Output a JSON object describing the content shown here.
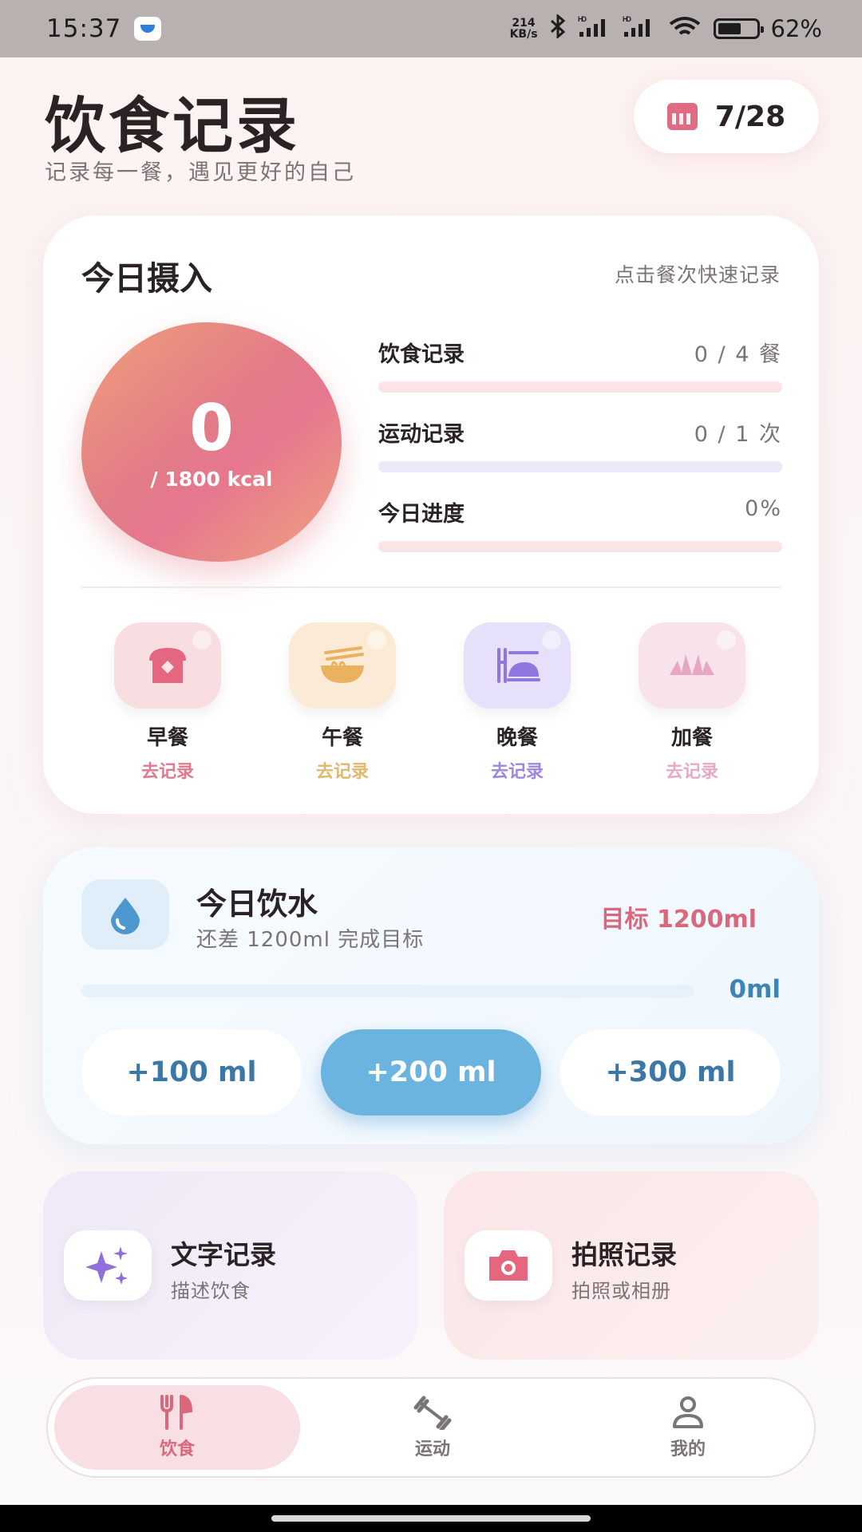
{
  "status_bar": {
    "time": "15:37",
    "net_speed_top": "214",
    "net_speed_bottom": "KB/s",
    "signal1": "HD",
    "signal2": "HD",
    "battery": "62%",
    "battery_level": 0.62
  },
  "header": {
    "title": "饮食记录",
    "subtitle": "记录每一餐，遇见更好的自己",
    "date": "7/28",
    "date_icon": "calendar-icon"
  },
  "intake": {
    "title": "今日摄入",
    "hint": "点击餐次快速记录",
    "kcal_value": "0",
    "kcal_goal": "/ 1800 kcal",
    "stats": [
      {
        "label": "饮食记录",
        "value": "0 / 4 餐",
        "progress": 0,
        "track_color": "#fbe4e6",
        "fill_color": "#e27b88"
      },
      {
        "label": "运动记录",
        "value": "0 / 1 次",
        "progress": 0,
        "track_color": "#ece8f8",
        "fill_color": "#9b86e0"
      },
      {
        "label": "今日进度",
        "value": "0%",
        "progress": 0,
        "track_color": "#fbe4e6",
        "fill_color": "#e27b88"
      }
    ],
    "meals": [
      {
        "name": "早餐",
        "action": "去记录",
        "icon": "toast-icon",
        "tile_color": "#f8dde1",
        "icon_color": "#e4677f",
        "action_color": "#e0798c"
      },
      {
        "name": "午餐",
        "action": "去记录",
        "icon": "noodle-bowl-icon",
        "tile_color": "#fbebd6",
        "icon_color": "#eab15e",
        "action_color": "#e2b76c"
      },
      {
        "name": "晚餐",
        "action": "去记录",
        "icon": "dinner-plate-icon",
        "tile_color": "#e6e0fb",
        "icon_color": "#8f77de",
        "action_color": "#9c86df"
      },
      {
        "name": "加餐",
        "action": "去记录",
        "icon": "croissant-icon",
        "tile_color": "#f8e3ec",
        "icon_color": "#e8a6c0",
        "action_color": "#e7a9c3"
      }
    ]
  },
  "water": {
    "icon": "water-drop-icon",
    "title": "今日饮水",
    "subtitle": "还差 1200ml 完成目标",
    "goal": "目标 1200ml",
    "amount": "0ml",
    "progress": 0,
    "buttons": [
      "+100 ml",
      "+200 ml",
      "+300 ml"
    ],
    "active_button": 1
  },
  "records": [
    {
      "title": "文字记录",
      "subtitle": "描述饮食",
      "icon": "sparkles-icon"
    },
    {
      "title": "拍照记录",
      "subtitle": "拍照或相册",
      "icon": "camera-icon"
    }
  ],
  "nav": {
    "items": [
      {
        "label": "饮食",
        "icon": "fork-knife-icon",
        "active": true
      },
      {
        "label": "运动",
        "icon": "dumbbell-icon",
        "active": false
      },
      {
        "label": "我的",
        "icon": "person-icon",
        "active": false
      }
    ]
  },
  "colors": {
    "accent_pink": "#e27b88",
    "accent_blue": "#6cb4e0",
    "text_dark": "#2b2225",
    "text_muted": "#7b7476"
  }
}
